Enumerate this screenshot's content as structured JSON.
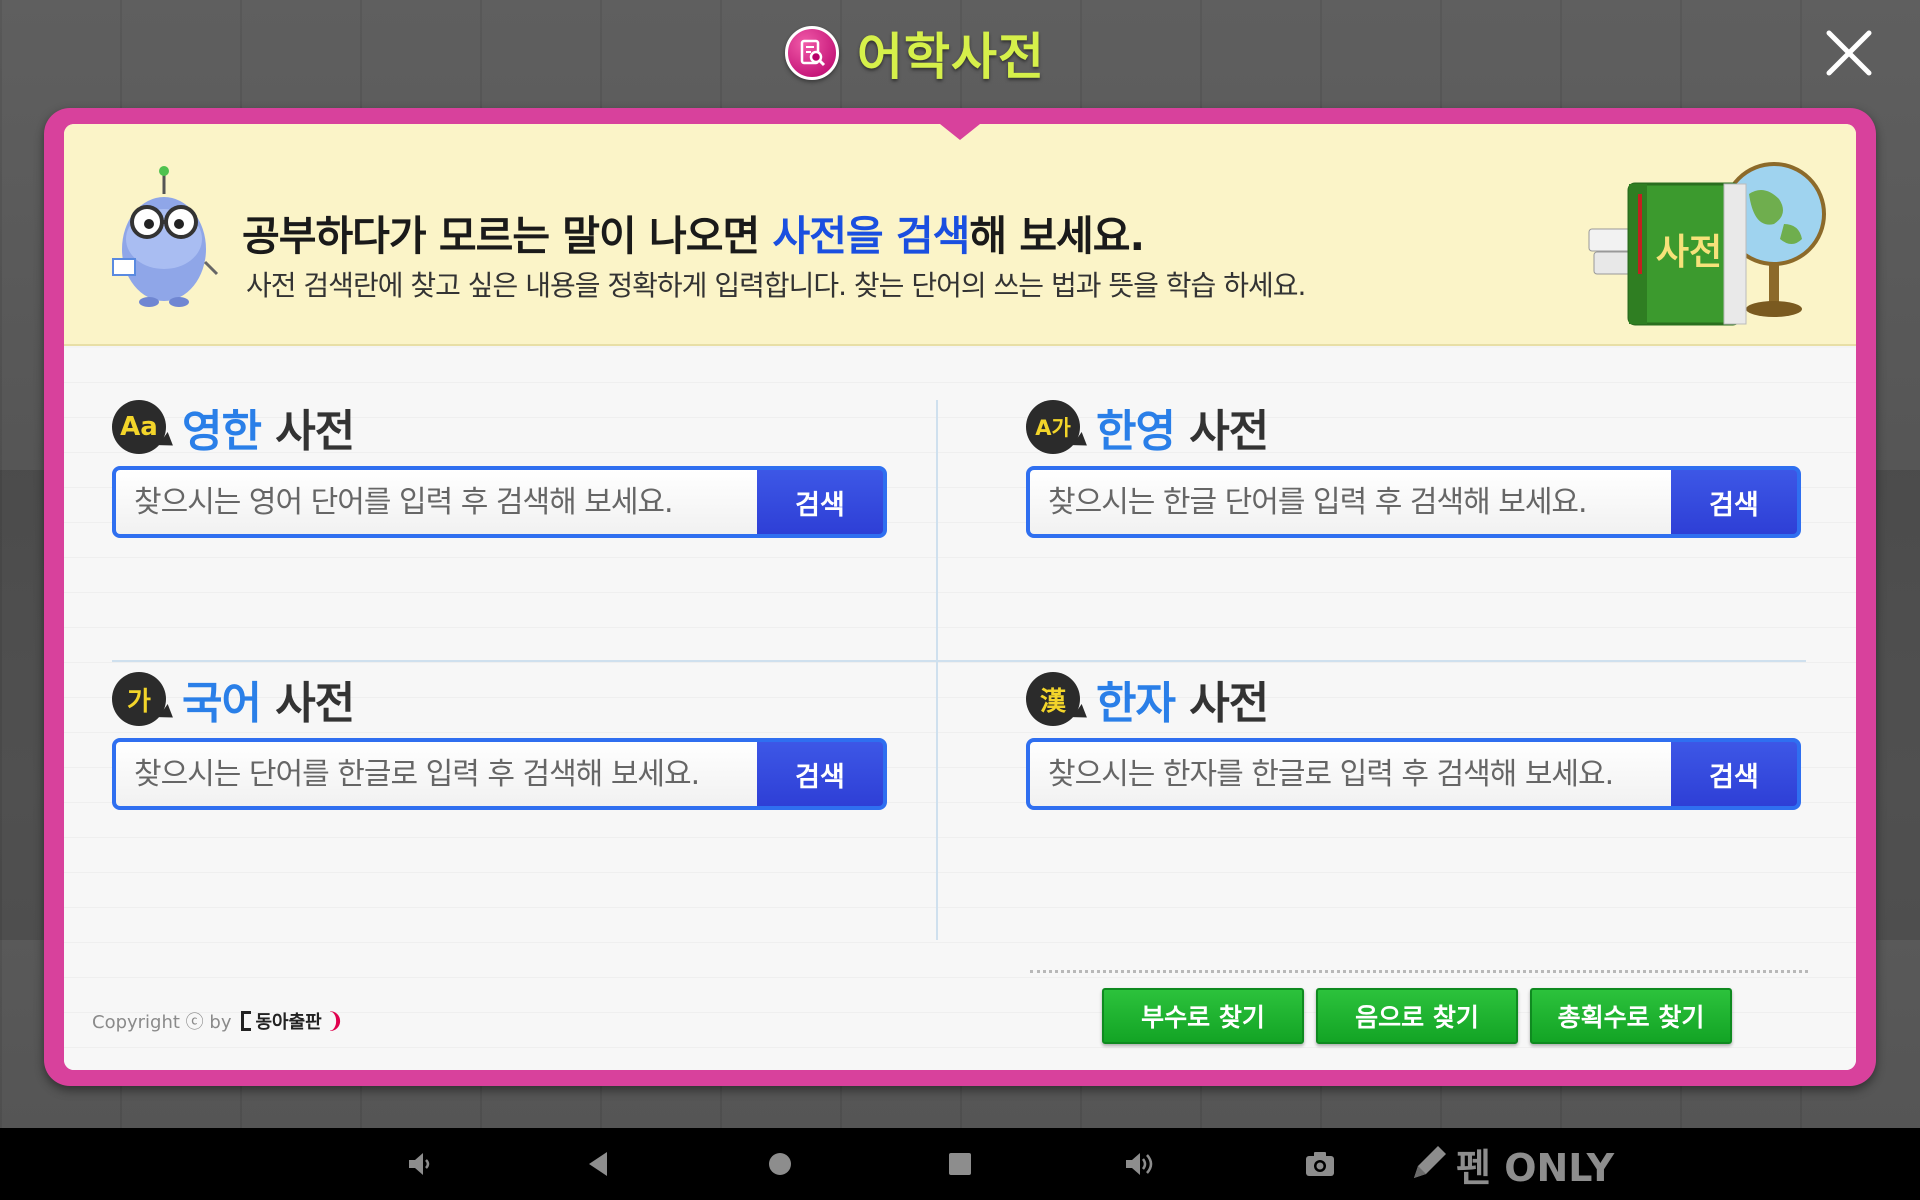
{
  "header": {
    "title": "어학사전",
    "icon": "dictionary-search-icon"
  },
  "banner": {
    "line1_pre": "공부하다가 모르는 말이 나오면 ",
    "line1_hl": "사전을 검색",
    "line1_post": "해 보세요.",
    "line2": "사전 검색란에 찾고 싶은 내용을 정확하게 입력합니다. 찾는 단어의 쓰는 법과 뜻을 학습 하세요.",
    "book_label": "사전"
  },
  "sections": [
    {
      "badge": "Aa",
      "name_blue": "영한",
      "name_dark": "사전",
      "placeholder": "찾으시는 영어 단어를 입력 후 검색해 보세요.",
      "button": "검색"
    },
    {
      "badge": "A가",
      "name_blue": "한영",
      "name_dark": "사전",
      "placeholder": "찾으시는 한글 단어를 입력 후 검색해 보세요.",
      "button": "검색"
    },
    {
      "badge": "가",
      "name_blue": "국어",
      "name_dark": "사전",
      "placeholder": "찾으시는 단어를 한글로 입력 후 검색해 보세요.",
      "button": "검색"
    },
    {
      "badge": "漢",
      "name_blue": "한자",
      "name_dark": "사전",
      "placeholder": "찾으시는 한자를 한글로 입력 후 검색해 보세요.",
      "button": "검색"
    }
  ],
  "hanja_buttons": [
    "부수로 찾기",
    "음으로 찾기",
    "총획수로 찾기"
  ],
  "footer": {
    "copyright": "Copyright ⓒ by",
    "publisher": "동아출판"
  },
  "navbar": {
    "items": [
      "volume-down-icon",
      "back-icon",
      "home-icon",
      "recents-icon",
      "volume-up-icon",
      "camera-icon"
    ],
    "pen_label": "펜 ONLY"
  },
  "colors": {
    "frame": "#d8419c",
    "accent_blue": "#2f6ff0",
    "title_green": "#d6f04a",
    "find_green": "#13a425"
  }
}
